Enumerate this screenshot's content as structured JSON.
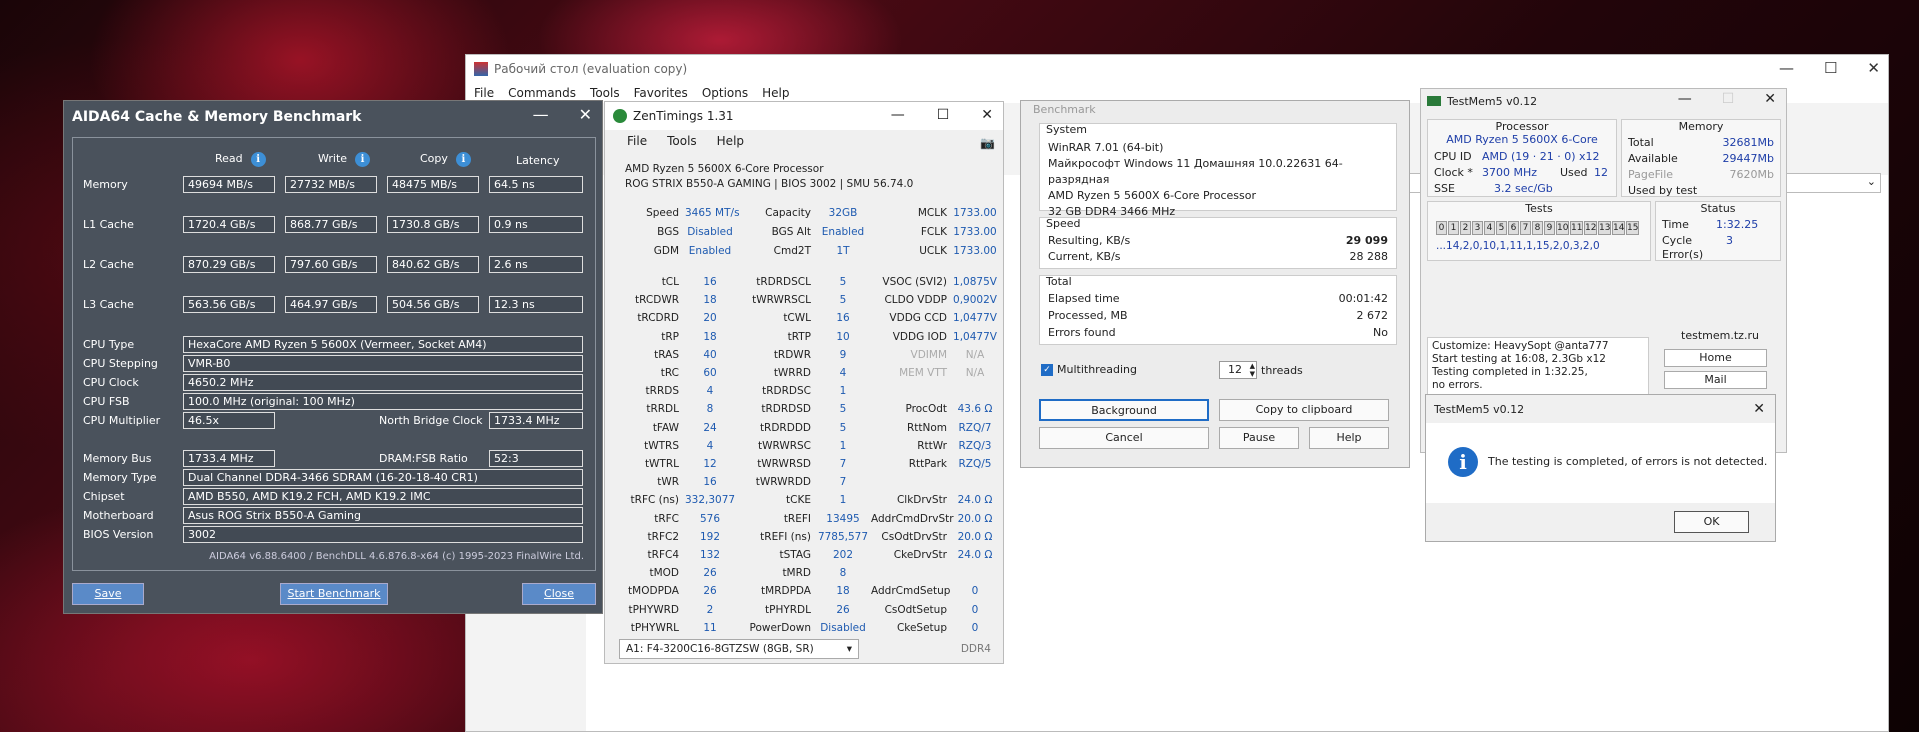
{
  "winrar": {
    "title": "Рабочий стол (evaluation copy)",
    "menu": [
      "File",
      "Commands",
      "Tools",
      "Favorites",
      "Options",
      "Help"
    ]
  },
  "aida": {
    "title": "AIDA64 Cache & Memory Benchmark",
    "headers": [
      "Read",
      "Write",
      "Copy",
      "Latency"
    ],
    "rows": [
      {
        "label": "Memory",
        "read": "49694 MB/s",
        "write": "27732 MB/s",
        "copy": "48475 MB/s",
        "latency": "64.5 ns"
      },
      {
        "label": "L1 Cache",
        "read": "1720.4 GB/s",
        "write": "868.77 GB/s",
        "copy": "1730.8 GB/s",
        "latency": "0.9 ns"
      },
      {
        "label": "L2 Cache",
        "read": "870.29 GB/s",
        "write": "797.60 GB/s",
        "copy": "840.62 GB/s",
        "latency": "2.6 ns"
      },
      {
        "label": "L3 Cache",
        "read": "563.56 GB/s",
        "write": "464.97 GB/s",
        "copy": "504.56 GB/s",
        "latency": "12.3 ns"
      }
    ],
    "cpu_type_label": "CPU Type",
    "cpu_type": "HexaCore AMD Ryzen 5 5600X  (Vermeer, Socket AM4)",
    "cpu_stepping_label": "CPU Stepping",
    "cpu_stepping": "VMR-B0",
    "cpu_clock_label": "CPU Clock",
    "cpu_clock": "4650.2 MHz",
    "cpu_fsb_label": "CPU FSB",
    "cpu_fsb": "100.0 MHz  (original: 100 MHz)",
    "cpu_mult_label": "CPU Multiplier",
    "cpu_mult": "46.5x",
    "nb_clock_label": "North Bridge Clock",
    "nb_clock": "1733.4 MHz",
    "mem_bus_label": "Memory Bus",
    "mem_bus": "1733.4 MHz",
    "dram_ratio_label": "DRAM:FSB Ratio",
    "dram_ratio": "52:3",
    "mem_type_label": "Memory Type",
    "mem_type": "Dual Channel DDR4-3466 SDRAM  (16-20-18-40 CR1)",
    "chipset_label": "Chipset",
    "chipset": "AMD B550, AMD K19.2 FCH, AMD K19.2 IMC",
    "mobo_label": "Motherboard",
    "mobo": "Asus ROG Strix B550-A Gaming",
    "bios_label": "BIOS Version",
    "bios": "3002",
    "footer": "AIDA64 v6.88.6400 / BenchDLL 4.6.876.8-x64  (c) 1995-2023 FinalWire Ltd.",
    "save": "Save",
    "start": "Start Benchmark",
    "close": "Close"
  },
  "zen": {
    "title": "ZenTimings 1.31",
    "menu": [
      "File",
      "Tools",
      "Help"
    ],
    "cpu": "AMD Ryzen 5 5600X 6-Core Processor",
    "board": "ROG STRIX B550-A GAMING | BIOS 3002 | SMU 56.74.0",
    "top": [
      [
        "Speed",
        "3465 MT/s",
        "Capacity",
        "32GB",
        "MCLK",
        "1733.00"
      ],
      [
        "BGS",
        "Disabled",
        "BGS Alt",
        "Enabled",
        "FCLK",
        "1733.00"
      ],
      [
        "GDM",
        "Enabled",
        "Cmd2T",
        "1T",
        "UCLK",
        "1733.00"
      ]
    ],
    "timings": [
      [
        "tCL",
        "16",
        "tRDRDSCL",
        "5",
        "VSOC (SVI2)",
        "1,0875V"
      ],
      [
        "tRCDWR",
        "18",
        "tWRWRSCL",
        "5",
        "CLDO VDDP",
        "0,9002V"
      ],
      [
        "tRCDRD",
        "20",
        "tCWL",
        "16",
        "VDDG CCD",
        "1,0477V"
      ],
      [
        "tRP",
        "18",
        "tRTP",
        "10",
        "VDDG IOD",
        "1,0477V"
      ],
      [
        "tRAS",
        "40",
        "tRDWR",
        "9",
        "VDIMM",
        "N/A"
      ],
      [
        "tRC",
        "60",
        "tWRRD",
        "4",
        "MEM VTT",
        "N/A"
      ],
      [
        "tRRDS",
        "4",
        "tRDRDSC",
        "1",
        "",
        ""
      ],
      [
        "tRRDL",
        "8",
        "tRDRDSD",
        "5",
        "ProcOdt",
        "43.6 Ω"
      ],
      [
        "tFAW",
        "24",
        "tRDRDDD",
        "5",
        "RttNom",
        "RZQ/7"
      ],
      [
        "tWTRS",
        "4",
        "tWRWRSC",
        "1",
        "RttWr",
        "RZQ/3"
      ],
      [
        "tWTRL",
        "12",
        "tWRWRSD",
        "7",
        "RttPark",
        "RZQ/5"
      ],
      [
        "tWR",
        "16",
        "tWRWRDD",
        "7",
        "",
        ""
      ],
      [
        "tRFC (ns)",
        "332,3077",
        "tCKE",
        "1",
        "ClkDrvStr",
        "24.0 Ω"
      ],
      [
        "tRFC",
        "576",
        "tREFI",
        "13495",
        "AddrCmdDrvStr",
        "20.0 Ω"
      ],
      [
        "tRFC2",
        "192",
        "tREFI (ns)",
        "7785,577",
        "CsOdtDrvStr",
        "20.0 Ω"
      ],
      [
        "tRFC4",
        "132",
        "tSTAG",
        "202",
        "CkeDrvStr",
        "24.0 Ω"
      ],
      [
        "tMOD",
        "26",
        "tMRD",
        "8",
        "",
        ""
      ],
      [
        "tMODPDA",
        "26",
        "tMRDPDA",
        "18",
        "AddrCmdSetup",
        "0"
      ],
      [
        "tPHYWRD",
        "2",
        "tPHYRDL",
        "26",
        "CsOdtSetup",
        "0"
      ],
      [
        "tPHYWRL",
        "11",
        "PowerDown",
        "Disabled",
        "CkeSetup",
        "0"
      ]
    ],
    "dimm": "A1: F4-3200C16-8GTZSW (8GB, SR)",
    "ddr": "DDR4"
  },
  "bench": {
    "title": "Benchmark",
    "system_label": "System",
    "system": [
      "WinRAR 7.01 (64-bit)",
      "Майкрософт Windows 11 Домашняя 10.0.22631 64-разрядная",
      "AMD Ryzen 5 5600X 6-Core Processor",
      "32 GB DDR4 3466 MHz"
    ],
    "speed_label": "Speed",
    "resulting_label": "Resulting, KB/s",
    "resulting": "29 099",
    "current_label": "Current, KB/s",
    "current": "28 288",
    "total_label": "Total",
    "elapsed_label": "Elapsed time",
    "elapsed": "00:01:42",
    "processed_label": "Processed, MB",
    "processed": "2 672",
    "errors_label": "Errors found",
    "errors": "No",
    "multithreading": "Multithreading",
    "threads": "12",
    "threads_label": "threads",
    "buttons": [
      "Background",
      "Copy to clipboard",
      "Cancel",
      "Pause",
      "Help"
    ]
  },
  "tm5": {
    "title": "TestMem5 v0.12",
    "processor_label": "Processor",
    "processor": "AMD Ryzen 5 5600X 6-Core",
    "cpuid_label": "CPU ID",
    "cpuid": "AMD  (19 · 21 · 0)  x12",
    "clock_label": "Clock *",
    "clock": "3700 MHz",
    "used_label": "Used",
    "used": "12",
    "sse_label": "SSE",
    "sse": "3.2 sec/Gb",
    "memory_label": "Memory",
    "total_label": "Total",
    "total": "32681Mb",
    "avail_label": "Available",
    "avail": "29447Mb",
    "pagefile_label": "PageFile",
    "pagefile": "7620Mb",
    "usedby_label": "Used by test",
    "tests_label": "Tests",
    "tests": [
      "0",
      "1",
      "2",
      "3",
      "4",
      "5",
      "6",
      "7",
      "8",
      "9",
      "10",
      "11",
      "12",
      "13",
      "14",
      "15"
    ],
    "seq": "...14,2,0,10,1,11,1,15,2,0,3,2,0",
    "status_label": "Status",
    "time_label": "Time",
    "time": "1:32.25",
    "cycle_label": "Cycle",
    "cycle": "3",
    "errors_label": "Error(s)",
    "log": [
      "Customize: HeavySopt @anta777",
      "Start testing at 16:08, 2.3Gb x12",
      "Testing completed in 1:32.25,",
      "no errors."
    ],
    "site": "testmem.tz.ru",
    "home": "Home",
    "mail": "Mail"
  },
  "dialog": {
    "title": "TestMem5 v0.12",
    "message": "The testing is completed, of errors is not detected.",
    "ok": "OK"
  }
}
